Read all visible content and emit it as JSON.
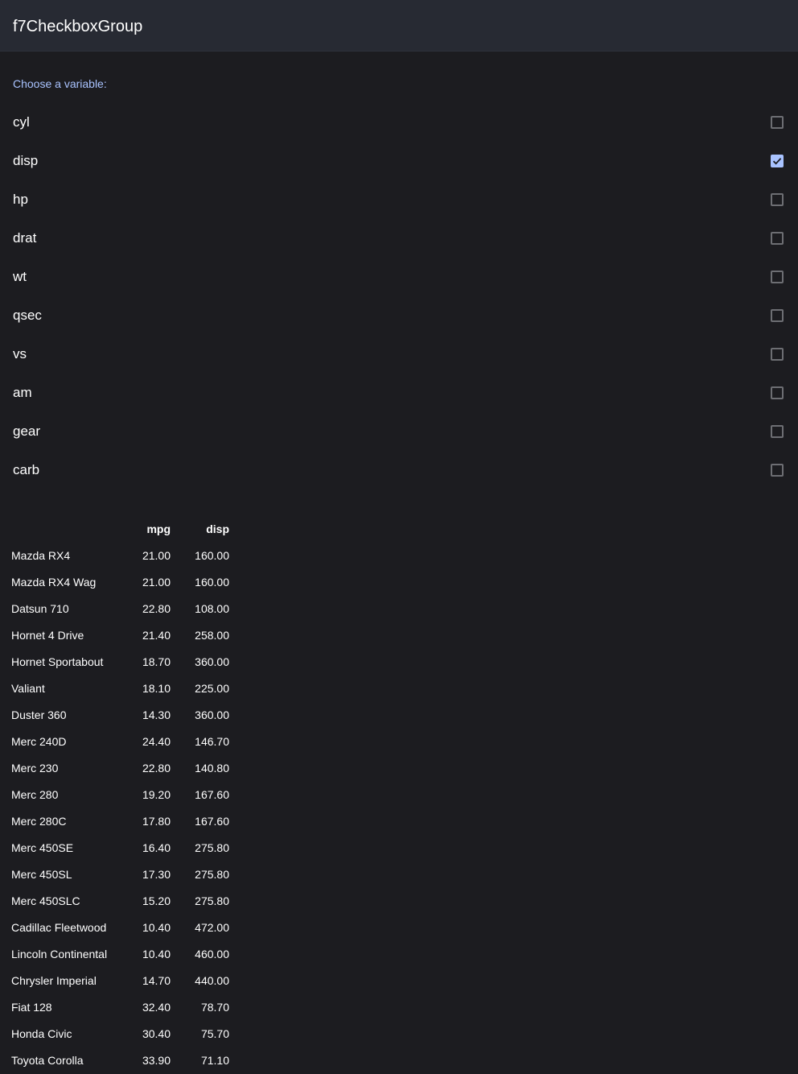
{
  "navbar": {
    "title": "f7CheckboxGroup"
  },
  "checkbox_group": {
    "label": "Choose a variable:",
    "options": [
      {
        "label": "cyl",
        "checked": false
      },
      {
        "label": "disp",
        "checked": true
      },
      {
        "label": "hp",
        "checked": false
      },
      {
        "label": "drat",
        "checked": false
      },
      {
        "label": "wt",
        "checked": false
      },
      {
        "label": "qsec",
        "checked": false
      },
      {
        "label": "vs",
        "checked": false
      },
      {
        "label": "am",
        "checked": false
      },
      {
        "label": "gear",
        "checked": false
      },
      {
        "label": "carb",
        "checked": false
      }
    ],
    "accent_color": "#a9c3ff"
  },
  "table": {
    "columns": [
      "",
      "mpg",
      "disp"
    ],
    "rows": [
      {
        "name": "Mazda RX4",
        "mpg": "21.00",
        "disp": "160.00"
      },
      {
        "name": "Mazda RX4 Wag",
        "mpg": "21.00",
        "disp": "160.00"
      },
      {
        "name": "Datsun 710",
        "mpg": "22.80",
        "disp": "108.00"
      },
      {
        "name": "Hornet 4 Drive",
        "mpg": "21.40",
        "disp": "258.00"
      },
      {
        "name": "Hornet Sportabout",
        "mpg": "18.70",
        "disp": "360.00"
      },
      {
        "name": "Valiant",
        "mpg": "18.10",
        "disp": "225.00"
      },
      {
        "name": "Duster 360",
        "mpg": "14.30",
        "disp": "360.00"
      },
      {
        "name": "Merc 240D",
        "mpg": "24.40",
        "disp": "146.70"
      },
      {
        "name": "Merc 230",
        "mpg": "22.80",
        "disp": "140.80"
      },
      {
        "name": "Merc 280",
        "mpg": "19.20",
        "disp": "167.60"
      },
      {
        "name": "Merc 280C",
        "mpg": "17.80",
        "disp": "167.60"
      },
      {
        "name": "Merc 450SE",
        "mpg": "16.40",
        "disp": "275.80"
      },
      {
        "name": "Merc 450SL",
        "mpg": "17.30",
        "disp": "275.80"
      },
      {
        "name": "Merc 450SLC",
        "mpg": "15.20",
        "disp": "275.80"
      },
      {
        "name": "Cadillac Fleetwood",
        "mpg": "10.40",
        "disp": "472.00"
      },
      {
        "name": "Lincoln Continental",
        "mpg": "10.40",
        "disp": "460.00"
      },
      {
        "name": "Chrysler Imperial",
        "mpg": "14.70",
        "disp": "440.00"
      },
      {
        "name": "Fiat 128",
        "mpg": "32.40",
        "disp": "78.70"
      },
      {
        "name": "Honda Civic",
        "mpg": "30.40",
        "disp": "75.70"
      },
      {
        "name": "Toyota Corolla",
        "mpg": "33.90",
        "disp": "71.10"
      }
    ]
  }
}
